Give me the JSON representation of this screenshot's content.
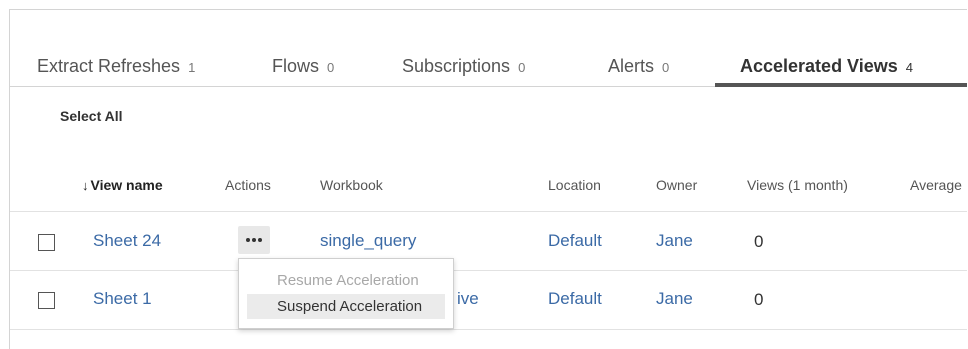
{
  "tabs": [
    {
      "label": "Extract Refreshes",
      "count": "1"
    },
    {
      "label": "Flows",
      "count": "0"
    },
    {
      "label": "Subscriptions",
      "count": "0"
    },
    {
      "label": "Alerts",
      "count": "0"
    },
    {
      "label": "Accelerated Views",
      "count": "4",
      "active": true
    }
  ],
  "toolbar": {
    "select_all": "Select All"
  },
  "table": {
    "columns": [
      "↓",
      "View name",
      "Actions",
      "Workbook",
      "Location",
      "Owner",
      "Views (1 month)",
      "Average"
    ],
    "rows": [
      {
        "view_name": "Sheet 24",
        "workbook": "single_query",
        "location": "Default",
        "owner": "Jane",
        "views": "0"
      },
      {
        "view_name": "Sheet 1",
        "workbook": "ive",
        "location": "Default",
        "owner": "Jane",
        "views": "0"
      }
    ]
  },
  "actions_menu": {
    "items": [
      "Resume Acceleration",
      "Suspend Acceleration"
    ],
    "disabled_index": 0,
    "hover_index": 1
  },
  "colors": {
    "link": "#3b6aa6",
    "active_tab_underline": "#555555",
    "menu_hover": "#ebebeb"
  }
}
